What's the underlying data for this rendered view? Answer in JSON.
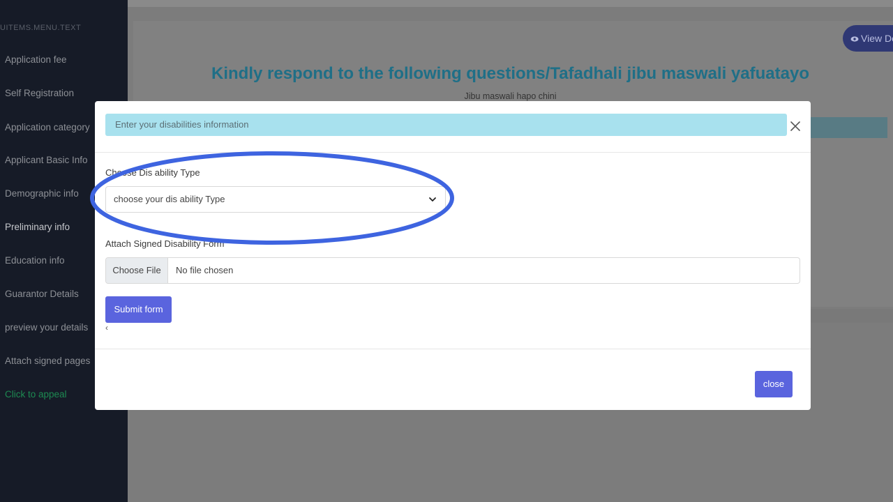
{
  "sidebar": {
    "heading": "UITEMS.MENU.TEXT",
    "items": [
      {
        "label": "Application fee"
      },
      {
        "label": "Self Registration"
      },
      {
        "label": "Application category"
      },
      {
        "label": "Applicant Basic Info"
      },
      {
        "label": "Demographic info"
      },
      {
        "label": "Preliminary info"
      },
      {
        "label": "Education info"
      },
      {
        "label": "Guarantor Details"
      },
      {
        "label": "preview your details"
      },
      {
        "label": "Attach signed pages"
      },
      {
        "label": "Click to appeal"
      }
    ]
  },
  "header": {
    "view_button": "View De"
  },
  "page": {
    "title": "Kindly respond to the following questions/Tafadhali jibu maswali yafuatayo",
    "subtitle": "Jibu maswali hapo chini"
  },
  "modal": {
    "header": "Enter your disabilities information",
    "disability_label": "Choose Dis ability Type",
    "disability_select_value": "choose your dis ability Type",
    "attach_label": "Attach Signed Disability Form",
    "file_button": "Choose File",
    "file_status": "No file chosen",
    "submit_label": "Submit form",
    "back_glyph": "‹",
    "close_label": "close"
  },
  "colors": {
    "accent": "#5a64de",
    "modal_header_bg": "#a8e1ee",
    "title_color": "#1f6f87",
    "annotation": "#3e64e0",
    "sidebar_bg": "#161b27",
    "appeal_green": "#1d8a52"
  },
  "icons": {
    "close": "close-icon",
    "chevron": "chevron-down-icon",
    "eye": "eye-icon"
  }
}
